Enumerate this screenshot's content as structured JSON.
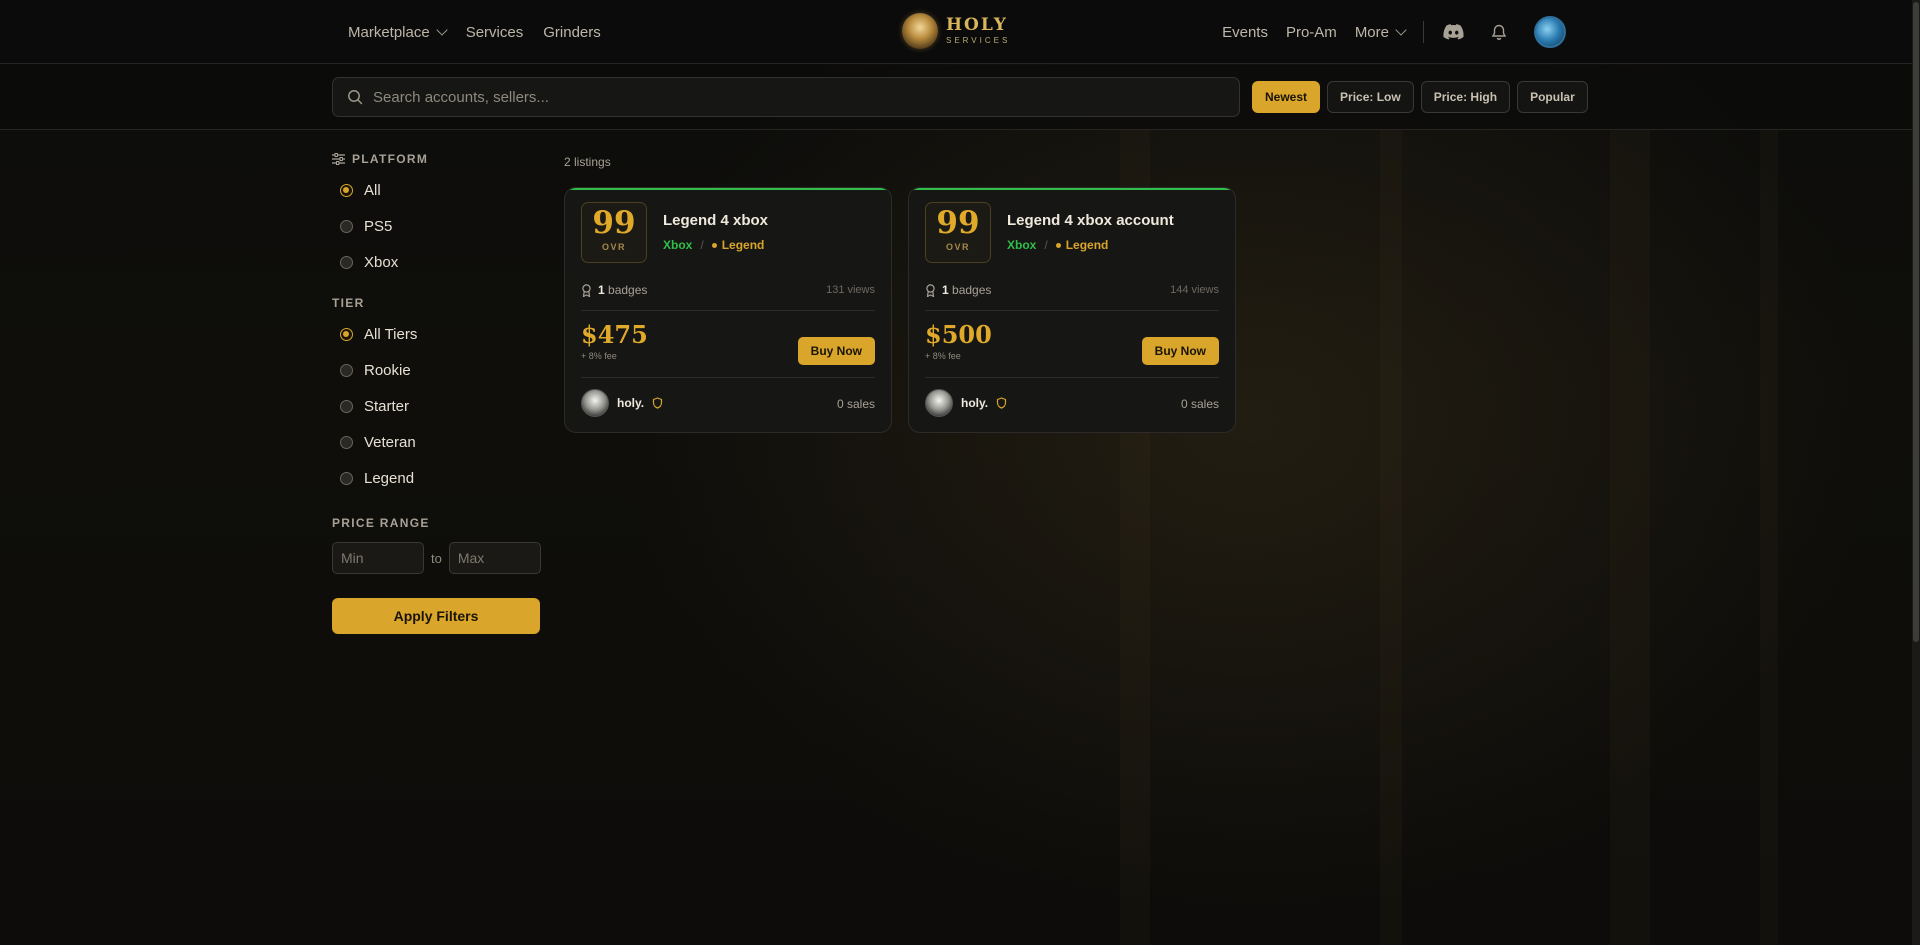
{
  "header": {
    "nav_left": [
      {
        "label": "Marketplace",
        "has_dropdown": true
      },
      {
        "label": "Services",
        "has_dropdown": false
      },
      {
        "label": "Grinders",
        "has_dropdown": false
      }
    ],
    "brand_title": "HOLY",
    "brand_subtitle": "SERVICES",
    "nav_right": [
      {
        "label": "Events"
      },
      {
        "label": "Pro-Am"
      },
      {
        "label": "More"
      }
    ]
  },
  "search": {
    "placeholder": "Search accounts, sellers...",
    "value": ""
  },
  "sort": {
    "options": [
      "Newest",
      "Price: Low",
      "Price: High",
      "Popular"
    ],
    "active": "Newest"
  },
  "filters": {
    "platform_title": "PLATFORM",
    "platform_options": [
      "All",
      "PS5",
      "Xbox"
    ],
    "platform_selected": "All",
    "tier_title": "TIER",
    "tier_options": [
      "All Tiers",
      "Rookie",
      "Starter",
      "Veteran",
      "Legend"
    ],
    "tier_selected": "All Tiers",
    "price_title": "PRICE RANGE",
    "min_placeholder": "Min",
    "max_placeholder": "Max",
    "to_label": "to",
    "apply_label": "Apply Filters"
  },
  "listings_count": "2 listings",
  "listings": [
    {
      "ovr": "99",
      "ovr_label": "OVR",
      "title": "Legend 4 xbox",
      "platform": "Xbox",
      "sep": "/",
      "tier": "Legend",
      "badges_count": "1",
      "badges_label": "badges",
      "views": "131 views",
      "price": "$475",
      "fee": "+ 8% fee",
      "buy_label": "Buy Now",
      "seller": "holy.",
      "sales": "0 sales"
    },
    {
      "ovr": "99",
      "ovr_label": "OVR",
      "title": "Legend 4 xbox account",
      "platform": "Xbox",
      "sep": "/",
      "tier": "Legend",
      "badges_count": "1",
      "badges_label": "badges",
      "views": "144 views",
      "price": "$500",
      "fee": "+ 8% fee",
      "buy_label": "Buy Now",
      "seller": "holy.",
      "sales": "0 sales"
    }
  ],
  "colors": {
    "accent": "#d9a52a",
    "platform_green": "#2fbf4a",
    "background": "#0b0b0a"
  }
}
